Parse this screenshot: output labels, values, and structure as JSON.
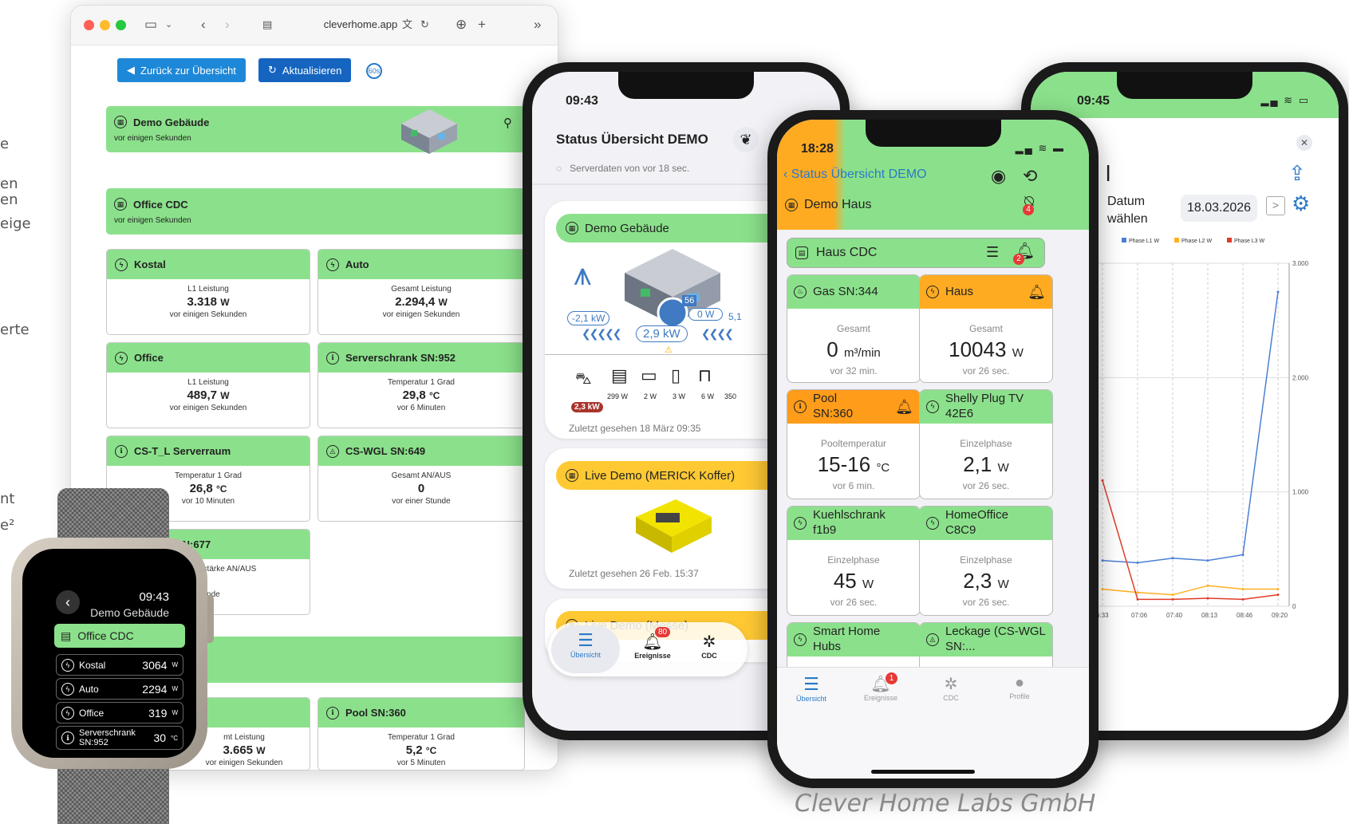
{
  "edge_text": [
    "e",
    "en",
    "en",
    "eige",
    "erte",
    "nt",
    "e²"
  ],
  "browser": {
    "url": "cleverhome.app",
    "back_button": "Zurück zur Übersicht",
    "refresh_button": "Aktualisieren",
    "refresh_interval": "60s",
    "buildings": [
      {
        "name": "Demo Gebäude",
        "time": "vor einigen Sekunden"
      },
      {
        "name": "Office CDC",
        "time": "vor einigen Sekunden"
      }
    ],
    "cards": [
      {
        "title": "Kostal",
        "label": "L1 Leistung",
        "value": "3.318",
        "unit": "W",
        "time": "vor einigen Sekunden"
      },
      {
        "title": "Auto",
        "label": "Gesamt Leistung",
        "value": "2.294,4",
        "unit": "W",
        "time": "vor einigen Sekunden"
      },
      {
        "title": "Office",
        "label": "L1 Leistung",
        "value": "489,7",
        "unit": "W",
        "time": "vor einigen Sekunden"
      },
      {
        "title": "Serverschrank SN:952",
        "label": "Temperatur 1 Grad",
        "value": "29,8",
        "unit": "°C",
        "time": "vor 6 Minuten"
      },
      {
        "title": "CS-T_L Serverraum",
        "label": "Temperatur 1 Grad",
        "value": "26,8",
        "unit": "°C",
        "time": "vor 10 Minuten"
      },
      {
        "title": "CS-WGL SN:649",
        "label": "Gesamt AN/AUS",
        "value": "0",
        "unit": "",
        "time": "vor einer Stunde"
      },
      {
        "title": "SN:677",
        "label": "gsstärke AN/AUS",
        "value": "1",
        "unit": "",
        "time": "Stunde"
      },
      {
        "title": "Pool SN:360",
        "label": "Temperatur 1 Grad",
        "value": "5,2",
        "unit": "°C",
        "time": "vor 5 Minuten"
      },
      {
        "title": "",
        "label": "mt Leistung",
        "value": "3.665",
        "unit": "W",
        "time": "vor einigen Sekunden"
      }
    ]
  },
  "phone2": {
    "time": "09:43",
    "title": "Status Übersicht DEMO",
    "server_status": "Serverdaten von vor 18 sec.",
    "demo": {
      "name": "Demo Gebäude",
      "grid": "-2,1 kW",
      "center": "2,9 kW",
      "battery_pct": "56",
      "battery_w": "0 W",
      "solar": "5,1",
      "car": "2,3 kW",
      "devices": [
        "299 W",
        "2 W",
        "3 W",
        "6 W",
        "350"
      ],
      "last_seen": "Zuletzt gesehen 18 März 09:35"
    },
    "live1": {
      "name": "Live Demo (MERICK Koffer)",
      "last_seen": "Zuletzt gesehen 26 Feb. 15:37"
    },
    "live2": {
      "name": "Live Demo (Messe)"
    },
    "tabs": {
      "overview": "Übersicht",
      "events": "Ereignisse",
      "events_badge": "80",
      "cdc": "CDC"
    }
  },
  "phone3": {
    "time": "18:28",
    "back": "Status Übersicht DEMO",
    "house": "Demo Haus",
    "house_badge": "4",
    "cdc": "Haus CDC",
    "cdc_badge": "2",
    "tiles": [
      {
        "title": "Gas SN:344",
        "label": "Gesamt",
        "value": "0",
        "unit": "m³/min",
        "time": "vor 32 min."
      },
      {
        "title": "Haus",
        "label": "Gesamt",
        "value": "10043",
        "unit": "W",
        "time": "vor 26 sec."
      },
      {
        "title": "Pool SN:360",
        "label": "Pooltemperatur",
        "value": "15-16",
        "unit": "°C",
        "time": "vor 6 min."
      },
      {
        "title": "Shelly Plug TV 42E6",
        "label": "Einzelphase",
        "value": "2,1",
        "unit": "W",
        "time": "vor 26 sec."
      },
      {
        "title": "Kuehlschrank f1b9",
        "label": "Einzelphase",
        "value": "45",
        "unit": "W",
        "time": "vor 26 sec."
      },
      {
        "title": "HomeOffice C8C9",
        "label": "Einzelphase",
        "value": "2,3",
        "unit": "W",
        "time": "vor 26 sec."
      },
      {
        "title": "Smart Home Hubs",
        "label": "",
        "value": "",
        "unit": "",
        "time": ""
      },
      {
        "title": "Leckage (CS-WGL SN:...",
        "label": "",
        "value": "",
        "unit": "",
        "time": ""
      }
    ],
    "tabs": {
      "overview": "Übersicht",
      "events": "Ereignisse",
      "events_badge": "1",
      "cdc": "CDC",
      "profile": "Profile"
    }
  },
  "phone4": {
    "time": "09:45",
    "title_fragment": "l",
    "date_label": "Datum wählen",
    "date": "18.03.2026",
    "legend": [
      "Phase L1 W",
      "Phase L2 W",
      "Phase L3 W"
    ],
    "y_ticks": [
      "3.000",
      "2.000",
      "1.000",
      "0"
    ],
    "x_ticks": [
      "6:33",
      "07:06",
      "07:40",
      "08:13",
      "08:46",
      "09:20"
    ]
  },
  "watch": {
    "time": "09:43",
    "title": "Demo Gebäude",
    "header_item": "Office CDC",
    "rows": [
      {
        "label": "Kostal",
        "value": "3064",
        "unit": "W"
      },
      {
        "label": "Auto",
        "value": "2294",
        "unit": "W"
      },
      {
        "label": "Office",
        "value": "319",
        "unit": "W"
      },
      {
        "label": "Serverschrank SN:952",
        "value": "30",
        "unit": "°C"
      }
    ]
  },
  "footer": "Clever Home Labs GmbH",
  "chart_data": {
    "type": "line",
    "x": [
      "6:33",
      "07:06",
      "07:40",
      "08:13",
      "08:46",
      "09:20"
    ],
    "ylim": [
      0,
      3000
    ],
    "series": [
      {
        "name": "Phase L1 W",
        "values": [
          400,
          380,
          420,
          400,
          450,
          2750
        ]
      },
      {
        "name": "Phase L2 W",
        "values": [
          150,
          120,
          100,
          180,
          150,
          150
        ]
      },
      {
        "name": "Phase L3 W",
        "values": [
          1100,
          60,
          60,
          70,
          60,
          100
        ]
      }
    ]
  }
}
